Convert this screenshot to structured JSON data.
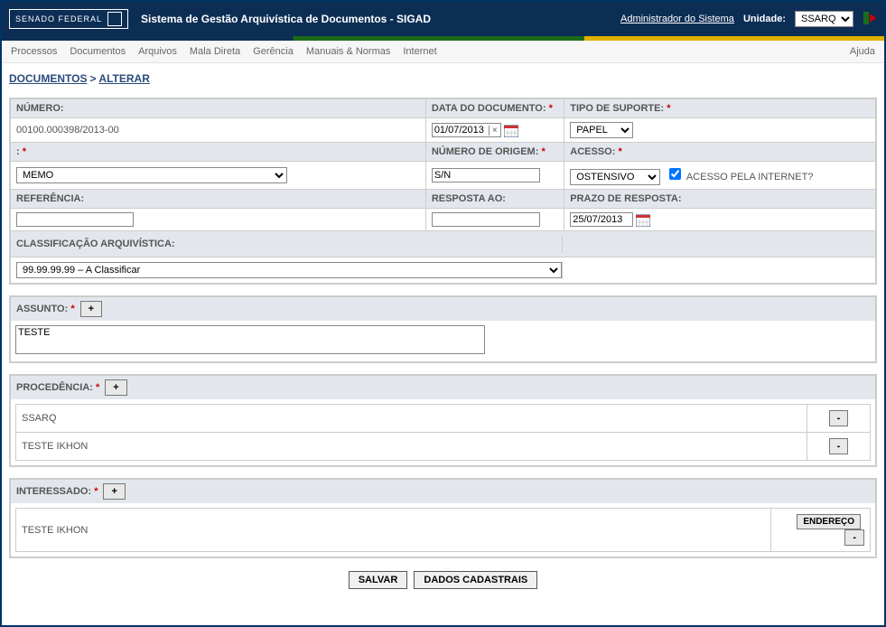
{
  "header": {
    "brand": "SENADO FEDERAL",
    "app_title": "Sistema de Gestão Arquivística de Documentos - SIGAD",
    "admin_link": "Administrador do Sistema",
    "unit_label": "Unidade:",
    "unit_value": "SSARQ"
  },
  "menu": {
    "items": [
      "Processos",
      "Documentos",
      "Arquivos",
      "Mala Direta",
      "Gerência",
      "Manuais & Normas",
      "Internet"
    ],
    "help": "Ajuda"
  },
  "breadcrumb": {
    "root": "DOCUMENTOS",
    "current": "ALTERAR"
  },
  "form": {
    "numero_label": "NÚMERO:",
    "numero_value": "00100.000398/2013-00",
    "data_doc_label": "DATA DO DOCUMENTO:",
    "data_doc_value": "01/07/2013",
    "tipo_suporte_label": "TIPO DE SUPORTE:",
    "tipo_suporte_value": "PAPEL",
    "colon_label": ":",
    "tipo_doc_value": "MEMO",
    "num_origem_label": "NÚMERO DE ORIGEM:",
    "num_origem_value": "S/N",
    "acesso_label": "ACESSO:",
    "acesso_value": "OSTENSIVO",
    "acesso_internet_label": "ACESSO PELA INTERNET?",
    "acesso_internet_checked": true,
    "referencia_label": "REFERÊNCIA:",
    "referencia_value": "",
    "resposta_label": "RESPOSTA AO:",
    "resposta_value": "",
    "prazo_label": "PRAZO DE RESPOSTA:",
    "prazo_value": "25/07/2013",
    "classificacao_label": "CLASSIFICAÇÃO ARQUIVÍSTICA:",
    "classificacao_value": "99.99.99.99 – A Classificar"
  },
  "assunto": {
    "label": "ASSUNTO:",
    "add_btn": "+",
    "text": "TESTE"
  },
  "procedencia": {
    "label": "PROCEDÊNCIA:",
    "add_btn": "+",
    "remove_btn": "-",
    "items": [
      "SSARQ",
      "TESTE IKHON"
    ]
  },
  "interessado": {
    "label": "INTERESSADO:",
    "add_btn": "+",
    "remove_btn": "-",
    "endereco_btn": "ENDEREÇO",
    "items": [
      "TESTE IKHON"
    ]
  },
  "actions": {
    "save": "SALVAR",
    "cadastrais": "DADOS CADASTRAIS"
  }
}
